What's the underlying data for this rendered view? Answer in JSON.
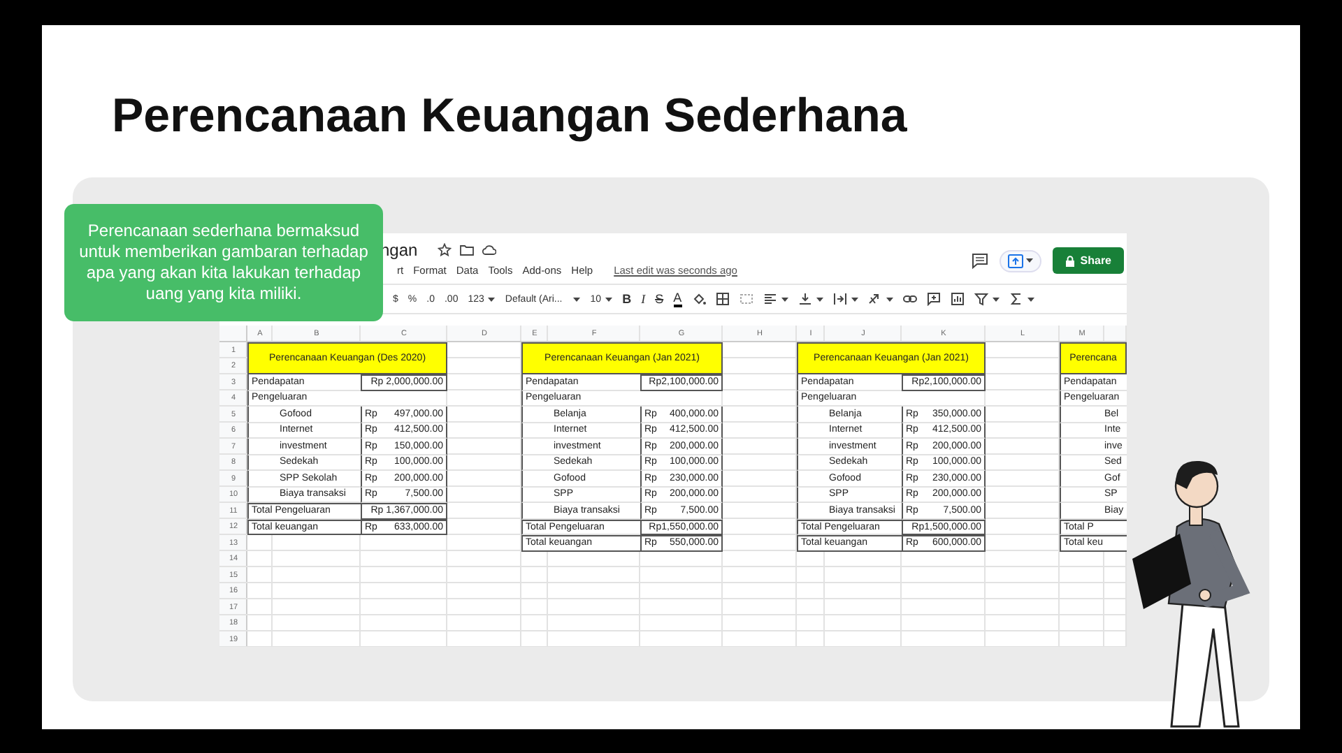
{
  "slide": {
    "title": "Perencanaan Keuangan Sederhana",
    "callout": "Perencanaan sederhana bermaksud untuk memberikan gambaran terhadap apa yang akan kita lakukan terhadap uang yang kita miliki."
  },
  "spreadsheet": {
    "doc_title": "ngan",
    "menu": [
      "rt",
      "Format",
      "Data",
      "Tools",
      "Add-ons",
      "Help"
    ],
    "last_edit": "Last edit was seconds ago",
    "share": "Share",
    "toolbar": [
      {
        "kind": "plain",
        "label": "$"
      },
      {
        "kind": "plain",
        "label": "%"
      },
      {
        "kind": "plain",
        "label": ".0"
      },
      {
        "kind": "plain",
        "label": ".00"
      },
      {
        "kind": "dropdown",
        "label": "123"
      },
      {
        "kind": "dropdown",
        "label": "Default (Ari..."
      },
      {
        "kind": "dropdown",
        "label": "10"
      },
      {
        "kind": "bold",
        "label": "B"
      },
      {
        "kind": "italic",
        "label": "I"
      },
      {
        "kind": "strike",
        "label": "S"
      },
      {
        "kind": "color",
        "label": "A"
      }
    ],
    "column_headers": [
      "A",
      "B",
      "C",
      "D",
      "E",
      "F",
      "G",
      "H",
      "I",
      "J",
      "K",
      "L",
      "M"
    ],
    "row_numbers": [
      "1",
      "2",
      "3",
      "4",
      "5",
      "6",
      "7",
      "8",
      "9",
      "10",
      "11",
      "12",
      "13",
      "14",
      "15",
      "16",
      "17",
      "18",
      "19"
    ],
    "blocks": [
      {
        "title": "Perencanaan Keuangan (Des 2020)",
        "rows": [
          {
            "kind": "income",
            "label": "Pendapatan",
            "amount": "Rp 2,000,000.00"
          },
          {
            "kind": "section",
            "label": "Pengeluaran"
          },
          {
            "kind": "item",
            "label": "Gofood",
            "currency": "Rp",
            "amount": "497,000.00"
          },
          {
            "kind": "item",
            "label": "Internet",
            "currency": "Rp",
            "amount": "412,500.00"
          },
          {
            "kind": "item",
            "label": "investment",
            "currency": "Rp",
            "amount": "150,000.00"
          },
          {
            "kind": "item",
            "label": "Sedekah",
            "currency": "Rp",
            "amount": "100,000.00"
          },
          {
            "kind": "item",
            "label": "SPP Sekolah",
            "currency": "Rp",
            "amount": "200,000.00"
          },
          {
            "kind": "item",
            "label": "Biaya transaksi",
            "currency": "Rp",
            "amount": "7,500.00"
          },
          {
            "kind": "total",
            "label": "Total Pengeluaran",
            "amount": "Rp 1,367,000.00"
          },
          {
            "kind": "total",
            "label": "Total keuangan",
            "currency": "Rp",
            "amount": "633,000.00"
          }
        ]
      },
      {
        "title": "Perencanaan Keuangan (Jan 2021)",
        "rows": [
          {
            "kind": "income",
            "label": "Pendapatan",
            "amount": "Rp2,100,000.00"
          },
          {
            "kind": "section",
            "label": "Pengeluaran"
          },
          {
            "kind": "item",
            "label": "Belanja",
            "currency": "Rp",
            "amount": "400,000.00"
          },
          {
            "kind": "item",
            "label": "Internet",
            "currency": "Rp",
            "amount": "412,500.00"
          },
          {
            "kind": "item",
            "label": "investment",
            "currency": "Rp",
            "amount": "200,000.00"
          },
          {
            "kind": "item",
            "label": "Sedekah",
            "currency": "Rp",
            "amount": "100,000.00"
          },
          {
            "kind": "item",
            "label": "Gofood",
            "currency": "Rp",
            "amount": "230,000.00"
          },
          {
            "kind": "item",
            "label": "SPP",
            "currency": "Rp",
            "amount": "200,000.00"
          },
          {
            "kind": "item",
            "label": "Biaya transaksi",
            "currency": "Rp",
            "amount": "7,500.00"
          },
          {
            "kind": "total",
            "label": "Total Pengeluaran",
            "amount": "Rp1,550,000.00"
          },
          {
            "kind": "total",
            "label": "Total keuangan",
            "currency": "Rp",
            "amount": "550,000.00"
          }
        ]
      },
      {
        "title": "Perencanaan Keuangan (Jan 2021)",
        "rows": [
          {
            "kind": "income",
            "label": "Pendapatan",
            "amount": "Rp2,100,000.00"
          },
          {
            "kind": "section",
            "label": "Pengeluaran"
          },
          {
            "kind": "item",
            "label": "Belanja",
            "currency": "Rp",
            "amount": "350,000.00"
          },
          {
            "kind": "item",
            "label": "Internet",
            "currency": "Rp",
            "amount": "412,500.00"
          },
          {
            "kind": "item",
            "label": "investment",
            "currency": "Rp",
            "amount": "200,000.00"
          },
          {
            "kind": "item",
            "label": "Sedekah",
            "currency": "Rp",
            "amount": "100,000.00"
          },
          {
            "kind": "item",
            "label": "Gofood",
            "currency": "Rp",
            "amount": "230,000.00"
          },
          {
            "kind": "item",
            "label": "SPP",
            "currency": "Rp",
            "amount": "200,000.00"
          },
          {
            "kind": "item",
            "label": "Biaya transaksi",
            "currency": "Rp",
            "amount": "7,500.00"
          },
          {
            "kind": "total",
            "label": "Total Pengeluaran",
            "amount": "Rp1,500,000.00"
          },
          {
            "kind": "total",
            "label": "Total keuangan",
            "currency": "Rp",
            "amount": "600,000.00"
          }
        ]
      },
      {
        "title": "Perencana",
        "rows": [
          {
            "kind": "income",
            "label": "Pendapatan"
          },
          {
            "kind": "section",
            "label": "Pengeluaran"
          },
          {
            "kind": "item",
            "label": "Bel"
          },
          {
            "kind": "item",
            "label": "Inte"
          },
          {
            "kind": "item",
            "label": "inve"
          },
          {
            "kind": "item",
            "label": "Sed"
          },
          {
            "kind": "item",
            "label": "Gof"
          },
          {
            "kind": "item",
            "label": "SP"
          },
          {
            "kind": "item",
            "label": "Biay"
          },
          {
            "kind": "total",
            "label": "Total P"
          },
          {
            "kind": "total",
            "label": "Total keu"
          }
        ]
      }
    ]
  }
}
